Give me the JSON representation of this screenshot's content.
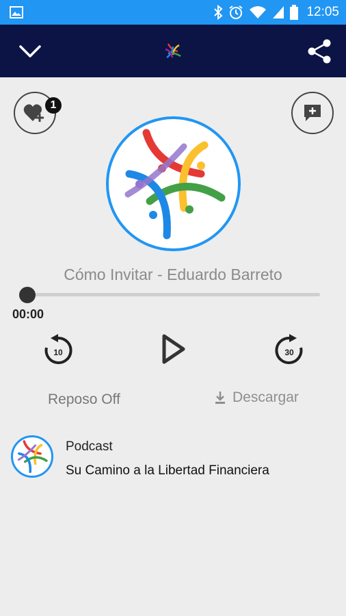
{
  "status_bar": {
    "time": "12:05",
    "icons": [
      "image-icon",
      "bluetooth-icon",
      "alarm-icon",
      "wifi-icon",
      "cell-signal-icon",
      "battery-icon"
    ],
    "bg_color": "#2196f3"
  },
  "app_bar": {
    "icons": [
      "chevron-down-icon",
      "app-logo-icon",
      "share-icon"
    ],
    "bg_color": "#0c1445"
  },
  "favorites": {
    "badge_count": "1"
  },
  "player": {
    "track_title": "Cómo Invitar - Eduardo Barreto",
    "elapsed_time": "00:00",
    "progress": 0,
    "rewind_seconds": "10",
    "forward_seconds": "30",
    "accent_color": "#2196f3"
  },
  "actions": {
    "sleep_label": "Reposo Off",
    "download_label": "Descargar"
  },
  "podcast": {
    "kicker": "Podcast",
    "name": "Su Camino a la Libertad Financiera"
  }
}
